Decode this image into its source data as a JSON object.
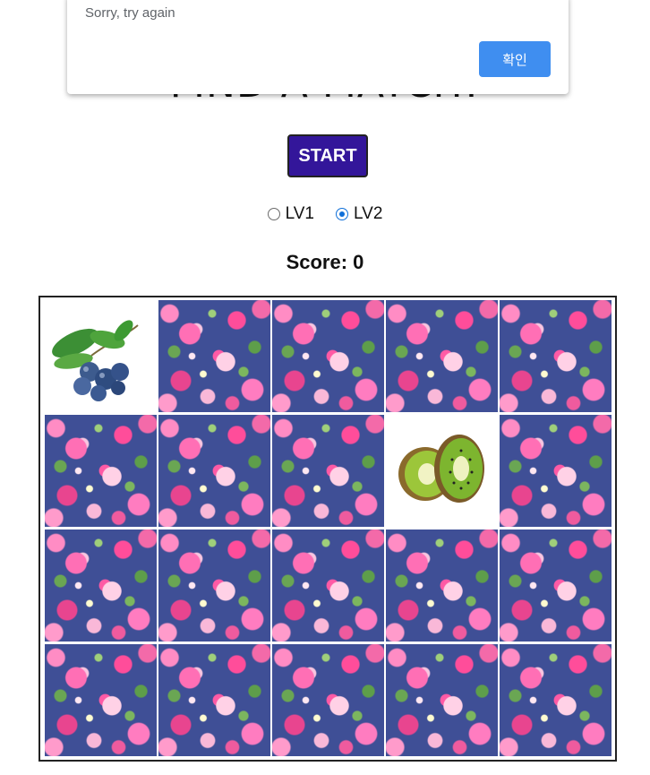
{
  "header": {
    "title": "FIND A MATCH!"
  },
  "controls": {
    "start_label": "START",
    "levels": [
      {
        "label": "LV1",
        "checked": false
      },
      {
        "label": "LV2",
        "checked": true
      }
    ],
    "score_label": "Score: 0"
  },
  "board": {
    "rows": 4,
    "cols": 5,
    "face_up": [
      {
        "index": 0,
        "fruit": "blueberries"
      },
      {
        "index": 8,
        "fruit": "kiwi"
      }
    ],
    "back_pattern": "pink floral on navy"
  },
  "dialog": {
    "message": "Sorry, try again",
    "ok_label": "확인"
  },
  "colors": {
    "start_button": "#33169a",
    "dialog_button": "#3f8ef0",
    "radio_checked": "#0f6fd8"
  }
}
